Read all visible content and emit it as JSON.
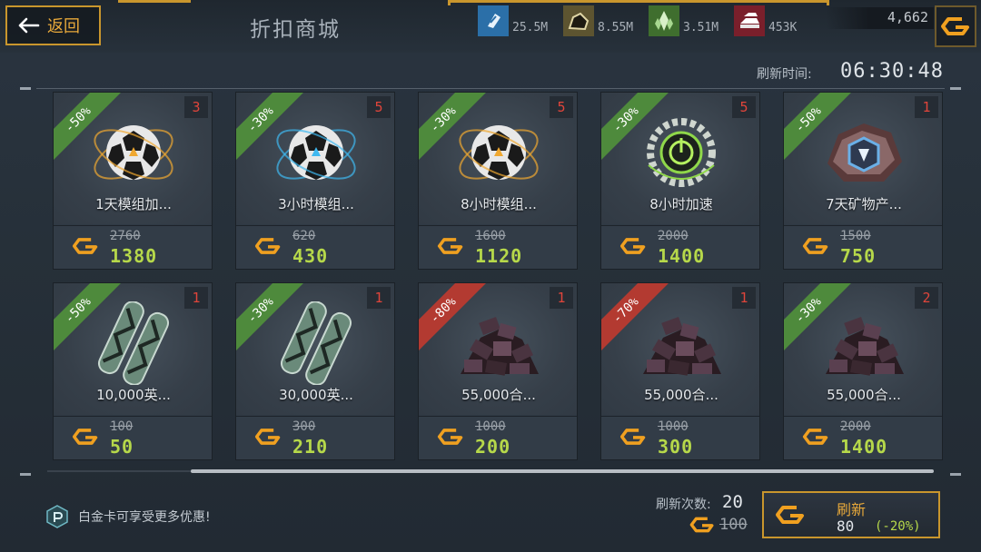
{
  "header": {
    "back_label": "返回",
    "title": "折扣商城",
    "resources": [
      {
        "icon": "blue-crystal-icon",
        "value": "25.5M",
        "color": "#2b6fa8"
      },
      {
        "icon": "ore-rock-icon",
        "value": "8.55M",
        "color": "#8a7a3a"
      },
      {
        "icon": "green-crystal-icon",
        "value": "3.51M",
        "color": "#4a8a3a"
      },
      {
        "icon": "metal-ingot-icon",
        "value": "453K",
        "color": "#8a2a34"
      }
    ],
    "gold_value": "4,662"
  },
  "refresh_timer": {
    "label": "刷新时间:",
    "value": "06:30:48"
  },
  "items": [
    {
      "name": "1天模组加...",
      "discount": "-50%",
      "discount_color": "green",
      "count": "3",
      "old_price": "2760",
      "new_price": "1380",
      "art": "module-orb-gold-icon"
    },
    {
      "name": "3小时模组...",
      "discount": "-30%",
      "discount_color": "green",
      "count": "5",
      "old_price": "620",
      "new_price": "430",
      "art": "module-orb-blue-icon"
    },
    {
      "name": "8小时模组...",
      "discount": "-30%",
      "discount_color": "green",
      "count": "5",
      "old_price": "1600",
      "new_price": "1120",
      "art": "module-orb-gold-icon"
    },
    {
      "name": "8小时加速",
      "discount": "-30%",
      "discount_color": "green",
      "count": "5",
      "old_price": "2000",
      "new_price": "1400",
      "art": "speedup-gear-icon"
    },
    {
      "name": "7天矿物产...",
      "discount": "-50%",
      "discount_color": "green",
      "count": "1",
      "old_price": "1500",
      "new_price": "750",
      "art": "mineral-production-icon"
    },
    {
      "name": "10,000英...",
      "discount": "-50%",
      "discount_color": "green",
      "count": "1",
      "old_price": "100",
      "new_price": "50",
      "art": "tube-capsule-icon"
    },
    {
      "name": "30,000英...",
      "discount": "-30%",
      "discount_color": "green",
      "count": "1",
      "old_price": "300",
      "new_price": "210",
      "art": "tube-capsule-icon"
    },
    {
      "name": "55,000合...",
      "discount": "-80%",
      "discount_color": "red",
      "count": "1",
      "old_price": "1000",
      "new_price": "200",
      "art": "alloy-pile-icon"
    },
    {
      "name": "55,000合...",
      "discount": "-70%",
      "discount_color": "red",
      "count": "1",
      "old_price": "1000",
      "new_price": "300",
      "art": "alloy-pile-icon"
    },
    {
      "name": "55,000合...",
      "discount": "-30%",
      "discount_color": "green",
      "count": "2",
      "old_price": "2000",
      "new_price": "1400",
      "art": "alloy-pile-icon"
    }
  ],
  "footer": {
    "vip_text": "白金卡可享受更多优惠!",
    "refresh_count_label": "刷新次数:",
    "refresh_count": "20",
    "old_cost": "100",
    "refresh_label": "刷新",
    "refresh_cost": "80",
    "refresh_discount": "(-20%)"
  }
}
